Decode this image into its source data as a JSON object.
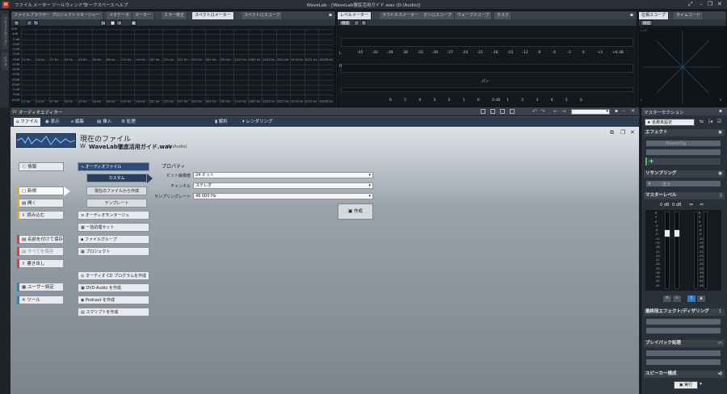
{
  "app": {
    "title": "WaveLab - [WaveLab徹底活用ガイド.wav (D:\\Audio)]",
    "menu": [
      "ファイル",
      "メーター",
      "ツールウィンドウ",
      "ワークスペース",
      "ヘルプ"
    ]
  },
  "left_strip": {
    "tabs": [
      "テキストエディター",
      "ビデオ"
    ]
  },
  "spectrum_panel": {
    "tabs": [
      "ファイルブラウザー",
      "プロジェクトマネージャー",
      "メタデータ",
      "マーカー",
      "エラー修正",
      "スペクトロメーター",
      "スペクトロスコープ"
    ],
    "active_tab": "スペクトロメーター",
    "db_labels": [
      "0dB",
      "-6dB",
      "-12dB",
      "-18dB",
      "-24dB",
      "-30dB",
      "-36dB",
      "-42dB",
      "-48dB",
      "-54dB",
      "-60dB",
      "-66dB",
      "-72dB",
      "-78dB",
      "-84dB"
    ],
    "freq_labels": [
      "21 Hz",
      "24 Hz",
      "27 Hz",
      "34 Hz",
      "43 Hz",
      "54 Hz",
      "66 Hz",
      "114 Hz",
      "144 Hz",
      "181 Hz",
      "221 Hz",
      "327 Hz",
      "421 Hz",
      "561 Hz",
      "761 Hz",
      "1147 Hz",
      "1587 Hz",
      "2423 Hz",
      "3522 Hz",
      "5119 Hz",
      "8131 Hz",
      "16438 Hz"
    ]
  },
  "level_panel": {
    "tabs": [
      "レベルメーター",
      "ラウドネスメーター",
      "オシロスコープ",
      "ウェーブスコープ",
      "タスク"
    ],
    "active_tab": "レベルメーター",
    "func_label": "機能",
    "scale": [
      "-45",
      "-42",
      "-39",
      "-36",
      "-33",
      "-30",
      "-27",
      "-24",
      "-21",
      "-18",
      "-15",
      "-12",
      "-9",
      "-6",
      "-3",
      "0",
      "+3",
      "+6 dB"
    ],
    "bottom_scale": [
      "6",
      "5",
      "4",
      "3",
      "2",
      "1",
      "0",
      "0 dB",
      "1",
      "2",
      "3",
      "4",
      "5",
      "6"
    ],
    "pan_label": "パン",
    "r_label": "R",
    "l_label": "L"
  },
  "phase_panel": {
    "tabs": [
      "位相スコープ",
      "タイムコード"
    ],
    "active_tab": "位相スコープ",
    "func_label": "機能",
    "corner_labels": [
      "L / S",
      "L",
      "R"
    ]
  },
  "audio_editor": {
    "title": "オーディオエディター",
    "ribbon": [
      "ファイル",
      "表示",
      "編集",
      "挿入",
      "処理",
      "解析",
      "レンダリング"
    ],
    "active_ribbon": "ファイル",
    "header": {
      "title": "現在のファイル",
      "file": "WaveLab徹底活用ガイド.wav",
      "path": "(D:\\Audio)"
    },
    "left_buttons": [
      "情報",
      "新規",
      "開く",
      "読み込む",
      "名前を付けて保存",
      "すべてを保存",
      "書き出し",
      "ユーザー設定",
      "ツール"
    ],
    "mid_buttons": [
      "オーディオファイル",
      "オーディオモンタージュ",
      "一括処理セット",
      "ファイルグループ",
      "プロジェクト",
      "オーディオ CD プログラムを作成",
      "DVD-Audio を作成",
      "Podcast を作成",
      "スクリプトを作成"
    ],
    "sub_buttons": [
      "カスタム",
      "現在のファイルから作成",
      "テンプレート"
    ],
    "properties": {
      "heading": "プロパティ",
      "rows": [
        {
          "label": "ビット解像度",
          "value": "24 ビット"
        },
        {
          "label": "チャンネル",
          "value": "ステレオ"
        },
        {
          "label": "サンプリングレート",
          "value": "48 000 Hz"
        }
      ],
      "create_label": "作成"
    }
  },
  "master_section": {
    "title": "マスターセクション",
    "preset_label": "名称未設定",
    "effects_label": "エフェクト",
    "effect_slots": [
      "MasterRig"
    ],
    "resampling_label": "リサンプリング",
    "resampling_value": "オフ",
    "master_level_label": "マスターレベル",
    "level_readout": [
      "0 dB",
      "0 dB"
    ],
    "final_effects_label": "最終段エフェクト/ディザリング",
    "playback_label": "プレイバック処理",
    "speaker_label": "スピーカー構成",
    "render_label": "実行",
    "db_ticks": [
      "6",
      "3",
      "0",
      "-3",
      "-6",
      "-9",
      "-12",
      "-15",
      "-18",
      "-21",
      "-24",
      "-27",
      "-30",
      "-33",
      "-36",
      "-39",
      "-42",
      "-45"
    ]
  }
}
